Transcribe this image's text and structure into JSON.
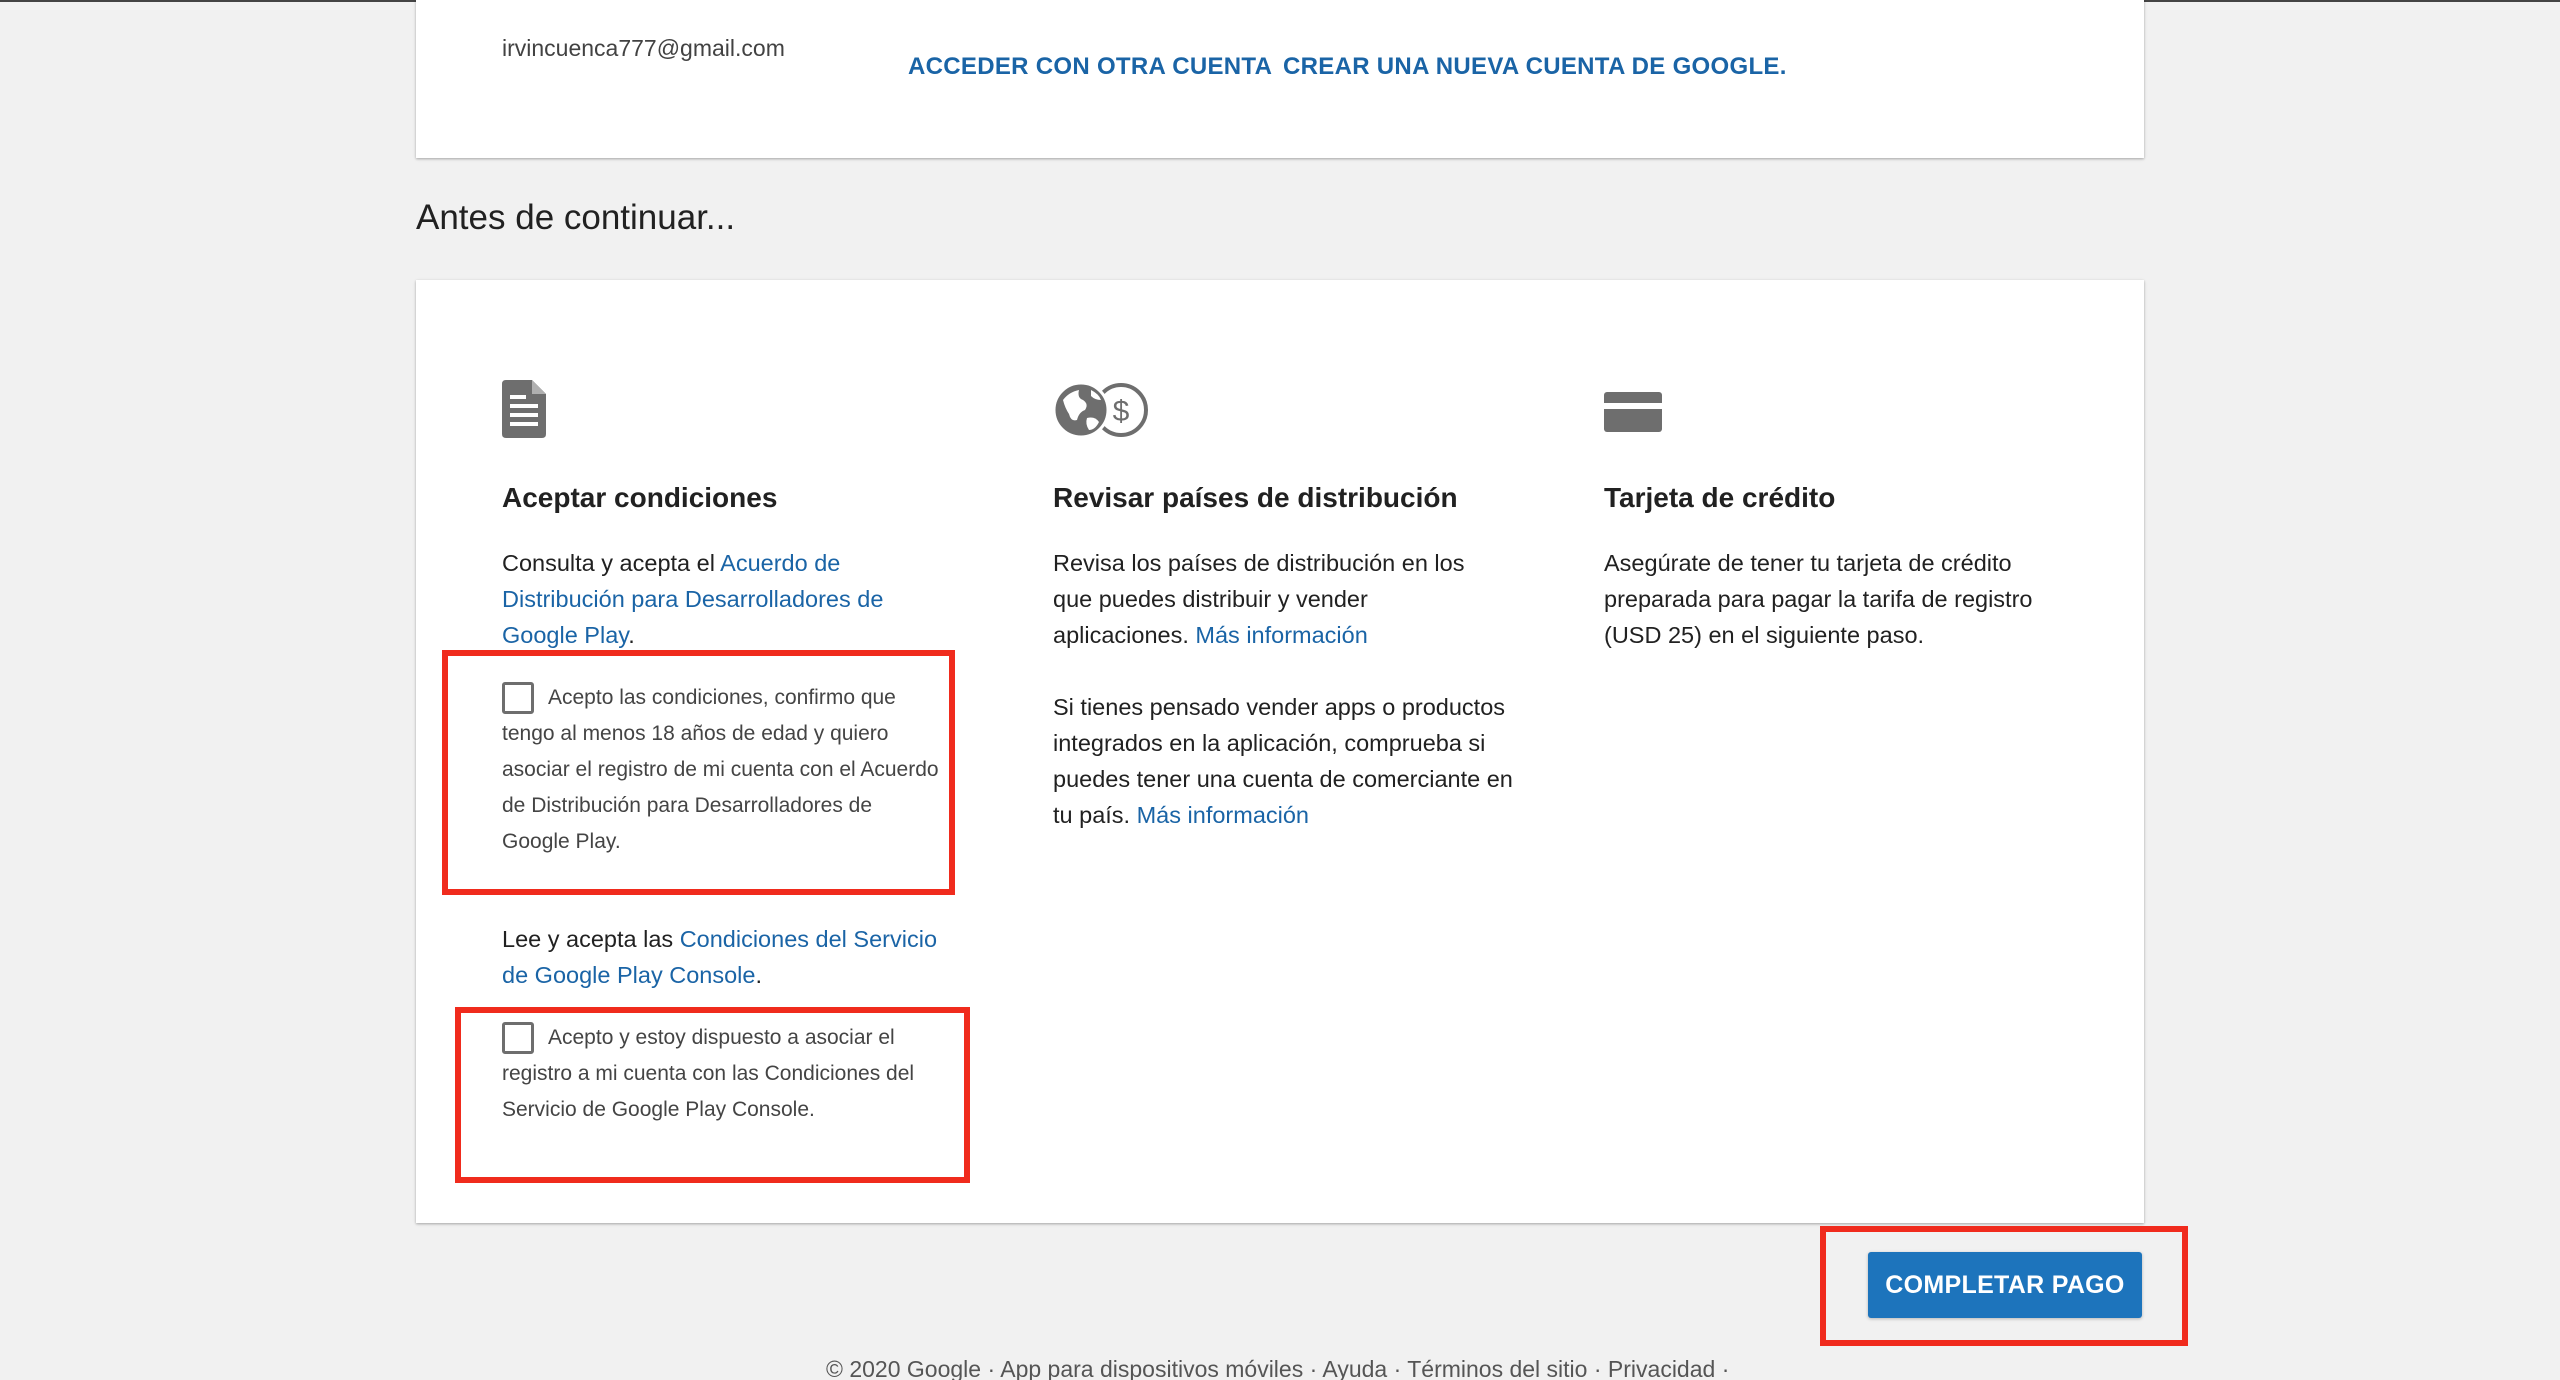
{
  "account": {
    "email": "irvincuenca777@gmail.com",
    "other_account_link": "ACCEDER CON OTRA CUENTA",
    "create_account_link": "CREAR UNA NUEVA CUENTA DE GOOGLE."
  },
  "section_title": "Antes de continuar...",
  "terms": {
    "heading": "Aceptar condiciones",
    "intro_prefix": "Consulta y acepta el ",
    "intro_link": "Acuerdo de Distribución para Desarrolladores de Google Play",
    "intro_suffix": ".",
    "checkbox1_label": "Acepto las condiciones, confirmo que tengo al menos 18 años de edad y quiero asociar el registro de mi cuenta con el Acuerdo de Distribución para Desarrolladores de Google Play.",
    "tos_prefix": "Lee y acepta las ",
    "tos_link": "Condiciones del Servicio de Google Play Console",
    "tos_suffix": ".",
    "checkbox2_label": "Acepto y estoy dispuesto a asociar el registro a mi cuenta con las Condiciones del Servicio de Google Play Console."
  },
  "distribution": {
    "heading": "Revisar países de distribución",
    "text1": "Revisa los países de distribución en los que puedes distribuir y vender aplicaciones. ",
    "link1": "Más información",
    "text2": "Si tienes pensado vender apps o productos integrados en la aplicación, comprueba si puedes tener una cuenta de comerciante en tu país. ",
    "link2": "Más información"
  },
  "credit_card": {
    "heading": "Tarjeta de crédito",
    "text": "Asegúrate de tener tu tarjeta de crédito preparada para pagar la tarifa de registro (USD 25) en el siguiente paso."
  },
  "pay_button": "COMPLETAR PAGO",
  "footer": {
    "copyright": "© 2020 Google",
    "links": [
      "App para dispositivos móviles",
      "Ayuda",
      "Términos del sitio",
      "Privacidad"
    ]
  },
  "colors": {
    "link_blue": "#1a64a6",
    "button_blue": "#1d74bc",
    "highlight_red": "#f02b1d",
    "background": "#f1f1f1"
  },
  "icons": [
    "document-icon",
    "globe-dollar-icon",
    "credit-card-icon"
  ]
}
